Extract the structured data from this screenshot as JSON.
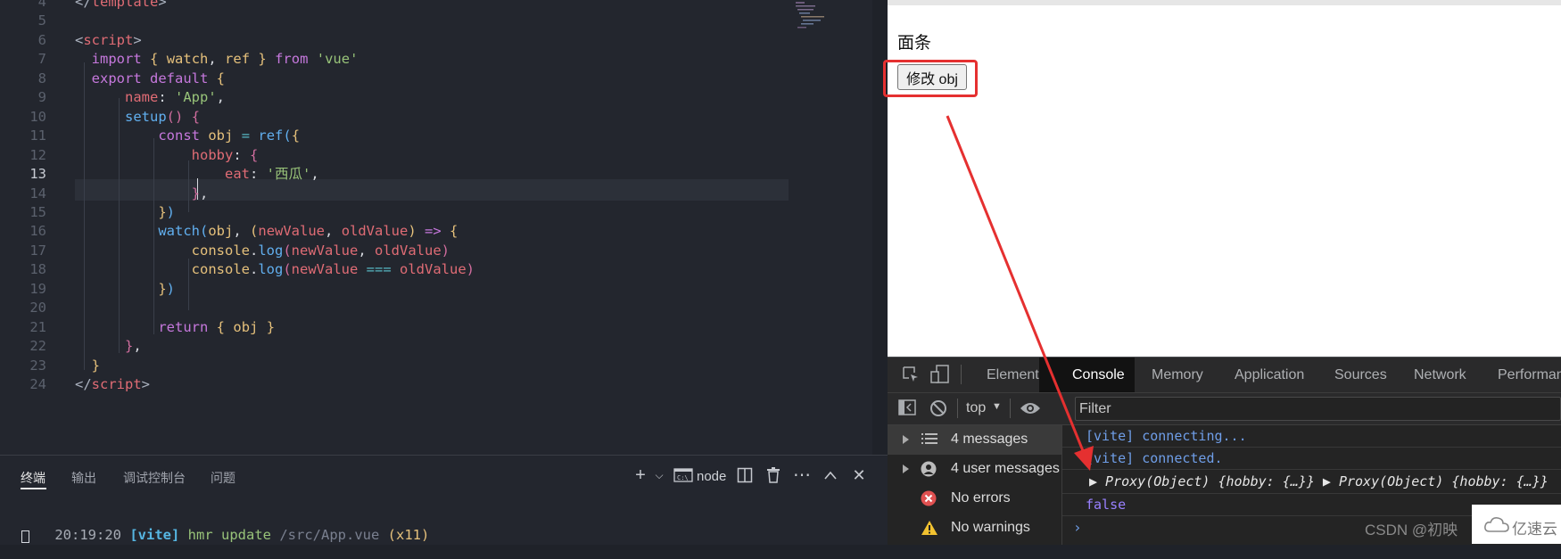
{
  "editor": {
    "lines": [
      {
        "num": "4",
        "html": "<span class='t-br'>&lt;/</span><span class='t-tag'>template</span><span class='t-br'>&gt;</span>"
      },
      {
        "num": "5",
        "html": ""
      },
      {
        "num": "6",
        "html": "<span class='t-br'>&lt;</span><span class='t-tag'>script</span><span class='t-br'>&gt;</span>"
      },
      {
        "num": "7",
        "html": "  <span class='t-kw'>import</span> <span class='t-gold'>{</span> <span class='t-var'>watch</span>, <span class='t-var'>ref</span> <span class='t-gold'>}</span> <span class='t-kw'>from</span> <span class='t-str'>'vue'</span>"
      },
      {
        "num": "8",
        "html": "  <span class='t-kw'>export default</span> <span class='t-gold'>{</span>"
      },
      {
        "num": "9",
        "html": "      <span class='t-prop'>name</span>: <span class='t-str'>'App'</span>,"
      },
      {
        "num": "10",
        "html": "      <span class='t-fn'>setup</span><span class='t-pink'>()</span> <span class='t-pink'>{</span>"
      },
      {
        "num": "11",
        "html": "          <span class='t-kw'>const</span> <span class='t-var'>obj</span> <span class='t-op'>=</span> <span class='t-fn'>ref</span><span class='t-fn'>(</span><span class='t-gold'>{</span>"
      },
      {
        "num": "12",
        "html": "              <span class='t-prop'>hobby</span>: <span class='t-pink'>{</span>"
      },
      {
        "num": "13",
        "html": "                  <span class='t-prop'>eat</span>: <span class='t-str'>'西瓜'</span>,"
      },
      {
        "num": "14",
        "html": "              <span class='t-pink'>}</span>,"
      },
      {
        "num": "15",
        "html": "          <span class='t-gold'>}</span><span class='t-fn'>)</span>"
      },
      {
        "num": "16",
        "html": "          <span class='t-fn'>watch</span><span class='t-fn'>(</span><span class='t-var'>obj</span>, <span class='t-gold'>(</span><span class='t-prop'>newValue</span>, <span class='t-prop'>oldValue</span><span class='t-gold'>)</span> <span class='t-kw'>=&gt;</span> <span class='t-gold'>{</span>"
      },
      {
        "num": "17",
        "html": "              <span class='t-var'>console</span>.<span class='t-fn'>log</span><span class='t-pink'>(</span><span class='t-prop'>newValue</span>, <span class='t-prop'>oldValue</span><span class='t-pink'>)</span>"
      },
      {
        "num": "18",
        "html": "              <span class='t-var'>console</span>.<span class='t-fn'>log</span><span class='t-pink'>(</span><span class='t-prop'>newValue</span> <span class='t-op'>===</span> <span class='t-prop'>oldValue</span><span class='t-pink'>)</span>"
      },
      {
        "num": "19",
        "html": "          <span class='t-gold'>}</span><span class='t-fn'>)</span>"
      },
      {
        "num": "20",
        "html": ""
      },
      {
        "num": "21",
        "html": "          <span class='t-kw'>return</span> <span class='t-gold'>{</span> <span class='t-var'>obj</span> <span class='t-gold'>}</span>"
      },
      {
        "num": "22",
        "html": "      <span class='t-pink'>}</span>,"
      },
      {
        "num": "23",
        "html": "  <span class='t-gold'>}</span>"
      },
      {
        "num": "24",
        "html": "<span class='t-br'>&lt;/</span><span class='t-tag'>script</span><span class='t-br'>&gt;</span>"
      }
    ],
    "active_line": "13"
  },
  "panel": {
    "tabs": [
      "终端",
      "输出",
      "调试控制台",
      "问题"
    ],
    "terminal_type": "node",
    "terminal_line": {
      "time": "20:19:20",
      "tag": "[vite]",
      "msg": "hmr update",
      "path": "/src/App.vue",
      "count": "(x11)"
    }
  },
  "browser": {
    "page_text": "面条",
    "button_label": "修改 obj"
  },
  "devtools": {
    "tabs": [
      "Elements",
      "Console",
      "Memory",
      "Application",
      "Sources",
      "Network",
      "Performan"
    ],
    "context": "top",
    "filter_placeholder": "Filter",
    "sidebar": [
      {
        "label": "4 messages",
        "icon": "list-icon"
      },
      {
        "label": "4 user messages",
        "icon": "user-icon"
      },
      {
        "label": "No errors",
        "icon": "error-icon"
      },
      {
        "label": "No warnings",
        "icon": "warning-icon"
      }
    ],
    "console": {
      "line1": "[vite] connecting...",
      "line2": "[vite] connected.",
      "line3": "▶ Proxy(Object) {hobby: {…}} ▶ Proxy(Object) {hobby: {…}}",
      "line4": "false"
    }
  },
  "overlay": {
    "watermark": "CSDN @初映",
    "logo_text": "亿速云"
  },
  "colors": {
    "highlight_red": "#e53030",
    "console_blue": "#6f9ee8",
    "error_red": "#e05151",
    "warning_yellow": "#f2c230"
  }
}
